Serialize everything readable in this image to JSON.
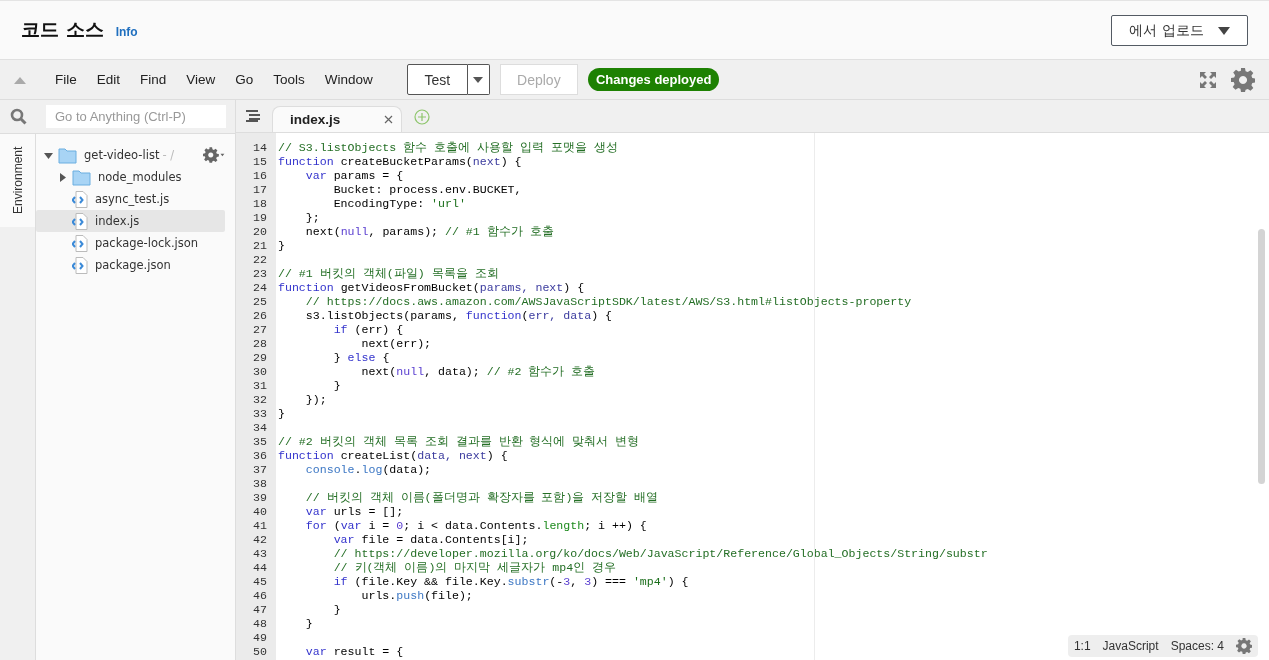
{
  "header": {
    "title": "코드 소스",
    "info_link": "Info",
    "upload_button": "에서 업로드"
  },
  "menu": [
    "File",
    "Edit",
    "Find",
    "View",
    "Go",
    "Tools",
    "Window"
  ],
  "toolbar": {
    "test_button": "Test",
    "deploy_button": {
      "label": "Deploy",
      "disabled": true
    },
    "status_badge": "Changes deployed"
  },
  "search": {
    "placeholder": "Go to Anything (Ctrl-P)"
  },
  "side_tabs": [
    {
      "label": "Environment",
      "selected": true
    }
  ],
  "tree": [
    {
      "name": "get-video-list",
      "suffix": " - /",
      "kind": "folder",
      "expanded": true,
      "selected": false,
      "children": [
        {
          "name": "node_modules",
          "kind": "folder",
          "expanded": false,
          "selected": false
        },
        {
          "name": "async_test.js",
          "kind": "file",
          "selected": false
        },
        {
          "name": "index.js",
          "kind": "file",
          "selected": true
        },
        {
          "name": "package-lock.json",
          "kind": "file",
          "selected": false
        },
        {
          "name": "package.json",
          "kind": "file",
          "selected": false
        }
      ]
    }
  ],
  "editor_tabs": [
    {
      "label": "index.js",
      "selected": true
    }
  ],
  "code": [
    {
      "n": "14",
      "tokens": [
        {
          "kind": "comment",
          "text": "// S3.listObjects 함수 호출에 사용할 입력 포맷을 생성"
        }
      ]
    },
    {
      "n": "15",
      "tokens": [
        {
          "kind": "keyword",
          "text": "function"
        },
        {
          "kind": "plain",
          "text": " createBucketParams("
        },
        {
          "kind": "param",
          "text": "next"
        },
        {
          "kind": "plain",
          "text": ") {"
        }
      ]
    },
    {
      "n": "16",
      "tokens": [
        {
          "kind": "keyword",
          "text": "    var"
        },
        {
          "kind": "plain",
          "text": " params = {"
        }
      ]
    },
    {
      "n": "17",
      "tokens": [
        {
          "kind": "plain",
          "text": "        Bucket: process.env.BUCKET,"
        }
      ]
    },
    {
      "n": "18",
      "tokens": [
        {
          "kind": "plain",
          "text": "        EncodingType: "
        },
        {
          "kind": "string",
          "text": "'url'"
        }
      ]
    },
    {
      "n": "19",
      "tokens": [
        {
          "kind": "plain",
          "text": "    };"
        }
      ]
    },
    {
      "n": "20",
      "tokens": [
        {
          "kind": "plain",
          "text": "    next("
        },
        {
          "kind": "constant",
          "text": "null"
        },
        {
          "kind": "plain",
          "text": ", params); "
        },
        {
          "kind": "comment",
          "text": "// #1 함수가 호출"
        }
      ]
    },
    {
      "n": "21",
      "tokens": [
        {
          "kind": "plain",
          "text": "}"
        }
      ]
    },
    {
      "n": "22"
    },
    {
      "n": "23",
      "tokens": [
        {
          "kind": "comment",
          "text": "// #1 버킷의 객체(파일) 목록을 조회"
        }
      ]
    },
    {
      "n": "24",
      "tokens": [
        {
          "kind": "keyword",
          "text": "function"
        },
        {
          "kind": "plain",
          "text": " getVideosFromBucket("
        },
        {
          "kind": "param",
          "text": "params, next"
        },
        {
          "kind": "plain",
          "text": ") {"
        }
      ]
    },
    {
      "n": "25",
      "tokens": [
        {
          "kind": "comment",
          "text": "    // https://docs.aws.amazon.com/AWSJavaScriptSDK/latest/AWS/S3.html#listObjects-property"
        }
      ]
    },
    {
      "n": "26",
      "tokens": [
        {
          "kind": "plain",
          "text": "    s3.listObjects(params, "
        },
        {
          "kind": "keyword",
          "text": "function"
        },
        {
          "kind": "plain",
          "text": "("
        },
        {
          "kind": "param",
          "text": "err, data"
        },
        {
          "kind": "plain",
          "text": ") {"
        }
      ]
    },
    {
      "n": "27",
      "tokens": [
        {
          "kind": "keyword",
          "text": "        if"
        },
        {
          "kind": "plain",
          "text": " (err) {"
        }
      ]
    },
    {
      "n": "28",
      "tokens": [
        {
          "kind": "plain",
          "text": "            next(err);"
        }
      ]
    },
    {
      "n": "29",
      "tokens": [
        {
          "kind": "plain",
          "text": "        } "
        },
        {
          "kind": "keyword",
          "text": "else"
        },
        {
          "kind": "plain",
          "text": " {"
        }
      ]
    },
    {
      "n": "30",
      "tokens": [
        {
          "kind": "plain",
          "text": "            next("
        },
        {
          "kind": "constant",
          "text": "null"
        },
        {
          "kind": "plain",
          "text": ", data); "
        },
        {
          "kind": "comment",
          "text": "// #2 함수가 호출"
        }
      ]
    },
    {
      "n": "31",
      "tokens": [
        {
          "kind": "plain",
          "text": "        }"
        }
      ]
    },
    {
      "n": "32",
      "tokens": [
        {
          "kind": "plain",
          "text": "    });"
        }
      ]
    },
    {
      "n": "33",
      "tokens": [
        {
          "kind": "plain",
          "text": "}"
        }
      ]
    },
    {
      "n": "34"
    },
    {
      "n": "35",
      "tokens": [
        {
          "kind": "comment",
          "text": "// #2 버킷의 객체 목록 조회 결과를 반환 형식에 맞춰서 변형"
        }
      ]
    },
    {
      "n": "36",
      "tokens": [
        {
          "kind": "keyword",
          "text": "function"
        },
        {
          "kind": "plain",
          "text": " createList("
        },
        {
          "kind": "param",
          "text": "data, next"
        },
        {
          "kind": "plain",
          "text": ") {"
        }
      ]
    },
    {
      "n": "37",
      "tokens": [
        {
          "kind": "builtin",
          "text": "    console"
        },
        {
          "kind": "plain",
          "text": "."
        },
        {
          "kind": "builtin",
          "text": "log"
        },
        {
          "kind": "plain",
          "text": "(data);"
        }
      ]
    },
    {
      "n": "38"
    },
    {
      "n": "39",
      "tokens": [
        {
          "kind": "comment",
          "text": "    // 버킷의 객체 이름(폴더명과 확장자를 포함)을 저장할 배열"
        }
      ]
    },
    {
      "n": "40",
      "tokens": [
        {
          "kind": "keyword",
          "text": "    var"
        },
        {
          "kind": "plain",
          "text": " urls = [];"
        }
      ]
    },
    {
      "n": "41",
      "tokens": [
        {
          "kind": "keyword",
          "text": "    for"
        },
        {
          "kind": "plain",
          "text": " ("
        },
        {
          "kind": "keyword",
          "text": "var"
        },
        {
          "kind": "plain",
          "text": " i = "
        },
        {
          "kind": "constant",
          "text": "0"
        },
        {
          "kind": "plain",
          "text": "; i < data.Contents."
        },
        {
          "kind": "support",
          "text": "length"
        },
        {
          "kind": "plain",
          "text": "; i ++) {"
        }
      ]
    },
    {
      "n": "42",
      "tokens": [
        {
          "kind": "keyword",
          "text": "        var"
        },
        {
          "kind": "plain",
          "text": " file = data.Contents[i];"
        }
      ]
    },
    {
      "n": "43",
      "tokens": [
        {
          "kind": "comment",
          "text": "        // https://developer.mozilla.org/ko/docs/Web/JavaScript/Reference/Global_Objects/String/substr"
        }
      ]
    },
    {
      "n": "44",
      "tokens": [
        {
          "kind": "comment",
          "text": "        // 키(객체 이름)의 마지막 세글자가 mp4인 경우"
        }
      ]
    },
    {
      "n": "45",
      "tokens": [
        {
          "kind": "keyword",
          "text": "        if"
        },
        {
          "kind": "plain",
          "text": " (file.Key && file.Key."
        },
        {
          "kind": "builtin",
          "text": "substr"
        },
        {
          "kind": "plain",
          "text": "(-"
        },
        {
          "kind": "constant",
          "text": "3"
        },
        {
          "kind": "plain",
          "text": ", "
        },
        {
          "kind": "constant",
          "text": "3"
        },
        {
          "kind": "plain",
          "text": ") === "
        },
        {
          "kind": "string",
          "text": "'mp4'"
        },
        {
          "kind": "plain",
          "text": ") {"
        }
      ]
    },
    {
      "n": "46",
      "tokens": [
        {
          "kind": "plain",
          "text": "            urls."
        },
        {
          "kind": "builtin",
          "text": "push"
        },
        {
          "kind": "plain",
          "text": "(file);"
        }
      ]
    },
    {
      "n": "47",
      "tokens": [
        {
          "kind": "plain",
          "text": "        }"
        }
      ]
    },
    {
      "n": "48",
      "tokens": [
        {
          "kind": "plain",
          "text": "    }"
        }
      ]
    },
    {
      "n": "49"
    },
    {
      "n": "50",
      "tokens": [
        {
          "kind": "keyword",
          "text": "    var"
        },
        {
          "kind": "plain",
          "text": " result = {"
        }
      ]
    }
  ],
  "status_bar": {
    "position": "1:1",
    "language": "JavaScript",
    "spaces": "Spaces: 4"
  }
}
